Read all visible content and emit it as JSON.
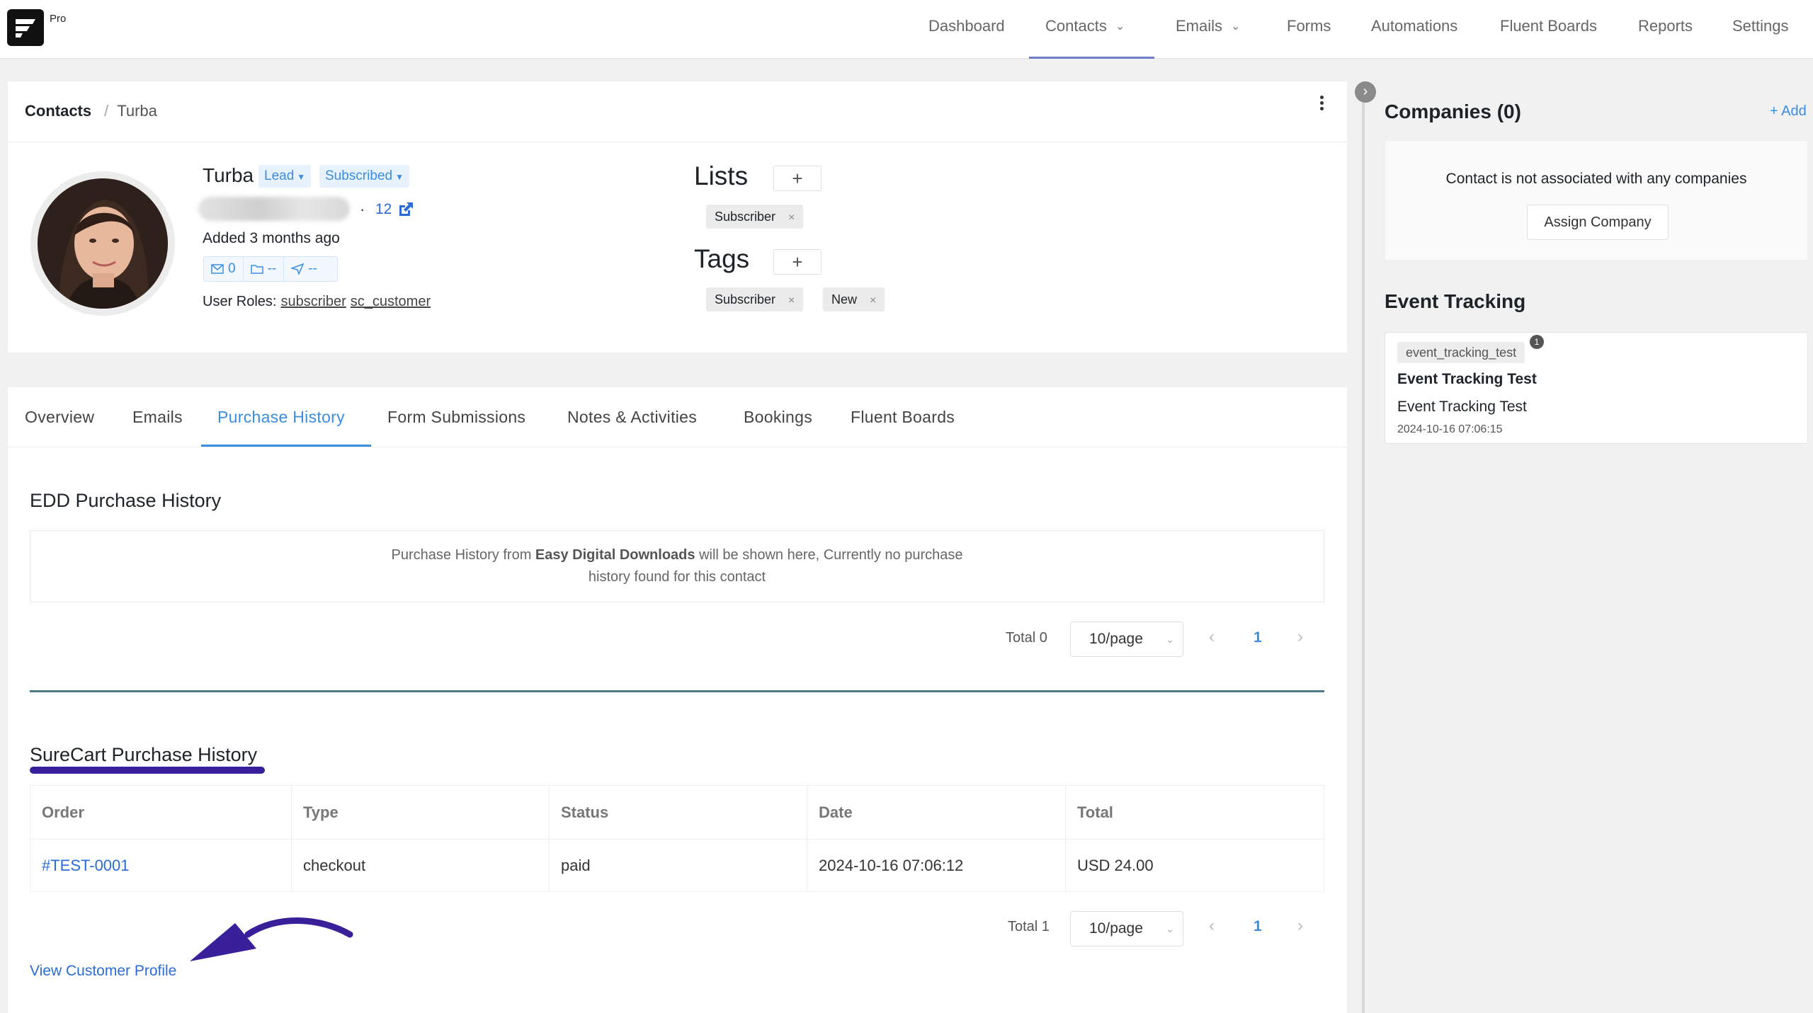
{
  "app": {
    "badge": "Pro"
  },
  "nav": {
    "items": [
      {
        "label": "Dashboard"
      },
      {
        "label": "Contacts"
      },
      {
        "label": "Emails"
      },
      {
        "label": "Forms"
      },
      {
        "label": "Automations"
      },
      {
        "label": "Fluent Boards"
      },
      {
        "label": "Reports"
      },
      {
        "label": "Settings"
      }
    ],
    "active": "Contacts"
  },
  "breadcrumb": {
    "root": "Contacts",
    "separator": "/",
    "current": "Turba"
  },
  "contact": {
    "name": "Turba",
    "status_pill": "Lead",
    "subscription_pill": "Subscribed",
    "dot": "·",
    "id": "12",
    "added": "Added 3 months ago",
    "stats": {
      "emails": "0",
      "folders": "--",
      "sent": "--"
    },
    "roles_label": "User Roles:",
    "roles": [
      "subscriber",
      "sc_customer"
    ]
  },
  "lists": {
    "heading": "Lists",
    "add": "+",
    "items": [
      {
        "label": "Subscriber",
        "remove": "×"
      }
    ]
  },
  "tags": {
    "heading": "Tags",
    "add": "+",
    "items": [
      {
        "label": "Subscriber",
        "remove": "×"
      },
      {
        "label": "New",
        "remove": "×"
      }
    ]
  },
  "tabs": [
    {
      "label": "Overview"
    },
    {
      "label": "Emails"
    },
    {
      "label": "Purchase History"
    },
    {
      "label": "Form Submissions"
    },
    {
      "label": "Notes & Activities"
    },
    {
      "label": "Bookings"
    },
    {
      "label": "Fluent Boards"
    }
  ],
  "active_tab": "Purchase History",
  "edd": {
    "title": "EDD Purchase History",
    "empty_prefix": "Purchase History from ",
    "empty_bold": "Easy Digital Downloads",
    "empty_suffix": " will be shown here, Currently no purchase",
    "empty_line2": "history found for this contact",
    "total": "Total 0",
    "page_size": "10/page",
    "page": "1"
  },
  "surecart": {
    "title": "SureCart Purchase History",
    "columns": [
      "Order",
      "Type",
      "Status",
      "Date",
      "Total"
    ],
    "rows": [
      {
        "order": "#TEST-0001",
        "type": "checkout",
        "status": "paid",
        "date": "2024-10-16 07:06:12",
        "total": "USD 24.00"
      }
    ],
    "total": "Total 1",
    "page_size": "10/page",
    "page": "1",
    "view_profile": "View Customer Profile"
  },
  "sidebar": {
    "companies_title": "Companies (0)",
    "add": "+ Add",
    "empty_companies": "Contact is not associated with any companies",
    "assign_button": "Assign Company",
    "event_title": "Event Tracking",
    "event": {
      "key": "event_tracking_test",
      "count": "1",
      "title": "Event Tracking Test",
      "value": "Event Tracking Test",
      "time": "2024-10-16 07:06:15"
    }
  },
  "colors": {
    "accent": "#3b8de0",
    "annotation": "#3a1f9b",
    "divider": "#4e7b89"
  }
}
